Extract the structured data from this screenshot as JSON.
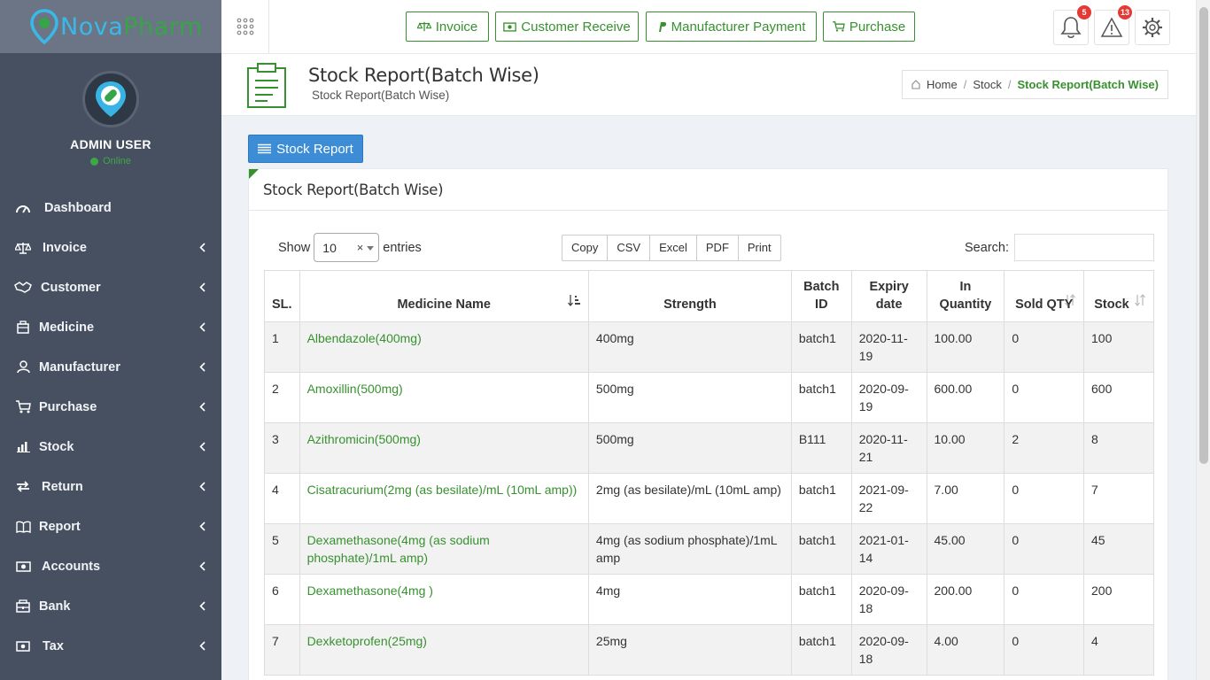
{
  "brand": {
    "name_part1": "Nova",
    "name_part2": "Pharm"
  },
  "user": {
    "name": "ADMIN USER",
    "status": "Online"
  },
  "sidebar": {
    "items": [
      {
        "label": "Dashboard",
        "icon": "dashboard-icon",
        "has_submenu": false
      },
      {
        "label": "Invoice",
        "icon": "balance-scale-icon",
        "has_submenu": true
      },
      {
        "label": "Customer",
        "icon": "handshake-icon",
        "has_submenu": true
      },
      {
        "label": "Medicine",
        "icon": "briefcase-icon",
        "has_submenu": true
      },
      {
        "label": "Manufacturer",
        "icon": "user-icon",
        "has_submenu": true
      },
      {
        "label": "Purchase",
        "icon": "cart-icon",
        "has_submenu": true
      },
      {
        "label": "Stock",
        "icon": "bar-chart-icon",
        "has_submenu": true
      },
      {
        "label": "Return",
        "icon": "exchange-icon",
        "has_submenu": true
      },
      {
        "label": "Report",
        "icon": "book-icon",
        "has_submenu": true
      },
      {
        "label": "Accounts",
        "icon": "money-icon",
        "has_submenu": true
      },
      {
        "label": "Bank",
        "icon": "bank-icon",
        "has_submenu": true
      },
      {
        "label": "Tax",
        "icon": "tax-icon",
        "has_submenu": true
      }
    ]
  },
  "header": {
    "quick_buttons": [
      {
        "label": "Invoice",
        "icon": "balance-scale-icon"
      },
      {
        "label": "Customer Receive",
        "icon": "money-icon"
      },
      {
        "label": "Manufacturer Payment",
        "icon": "paypal-icon"
      },
      {
        "label": "Purchase",
        "icon": "cart-icon"
      }
    ],
    "notifications_count": "5",
    "alerts_count": "13"
  },
  "page": {
    "title": "Stock Report(Batch Wise)",
    "subtitle": "Stock Report(Batch Wise)",
    "breadcrumb": [
      "Home",
      "Stock",
      "Stock Report(Batch Wise)"
    ]
  },
  "stock_report_button": "Stock Report",
  "panel": {
    "title": "Stock Report(Batch Wise)",
    "show_label": "Show",
    "entries_label": "entries",
    "page_length": "10",
    "export_buttons": [
      "Copy",
      "CSV",
      "Excel",
      "PDF",
      "Print"
    ],
    "search_label": "Search:",
    "search_value": ""
  },
  "table": {
    "headers": [
      "SL.",
      "Medicine Name",
      "Strength",
      "Batch ID",
      "Expiry date",
      "In Quantity",
      "Sold QTY",
      "Stock"
    ],
    "rows": [
      [
        "1",
        "Albendazole(400mg)",
        "400mg",
        "batch1",
        "2020-11-19",
        "100.00",
        "0",
        "100"
      ],
      [
        "2",
        "Amoxillin(500mg)",
        "500mg",
        "batch1",
        "2020-09-19",
        "600.00",
        "0",
        "600"
      ],
      [
        "3",
        "Azithromicin(500mg)",
        "500mg",
        "B111",
        "2020-11-21",
        "10.00",
        "2",
        "8"
      ],
      [
        "4",
        "Cisatracurium(2mg (as besilate)/mL (10mL amp))",
        "2mg (as besilate)/mL (10mL amp)",
        "batch1",
        "2021-09-22",
        "7.00",
        "0",
        "7"
      ],
      [
        "5",
        "Dexamethasone(4mg (as sodium phosphate)/1mL amp)",
        "4mg (as sodium phosphate)/1mL amp",
        "batch1",
        "2021-01-14",
        "45.00",
        "0",
        "45"
      ],
      [
        "6",
        "Dexamethasone(4mg )",
        "4mg",
        "batch1",
        "2020-09-18",
        "200.00",
        "0",
        "200"
      ],
      [
        "7",
        "Dexketoprofen(25mg)",
        "25mg",
        "batch1",
        "2020-09-18",
        "4.00",
        "0",
        "4"
      ]
    ]
  },
  "colors": {
    "accent_green": "#37912f",
    "sidebar_bg": "#465061",
    "primary_blue": "#3c8cd6"
  }
}
